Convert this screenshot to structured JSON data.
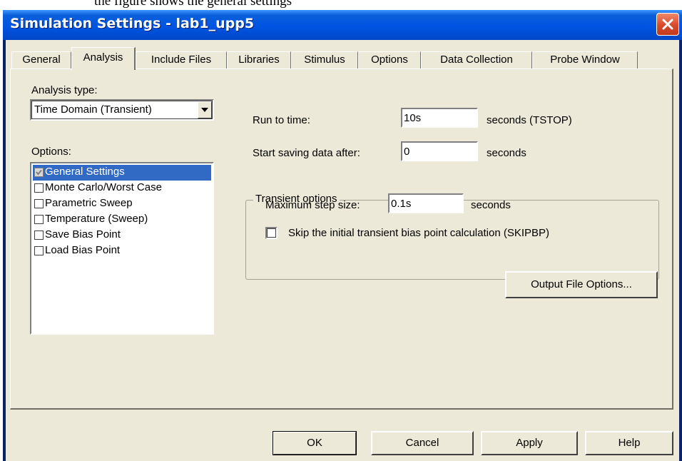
{
  "background_caption": "the figure shows the general settings",
  "window": {
    "title": "Simulation Settings - lab1_upp5",
    "close_icon": "close-x-icon"
  },
  "tabs": [
    {
      "label": "General",
      "active": false
    },
    {
      "label": "Analysis",
      "active": true
    },
    {
      "label": "Include Files",
      "active": false
    },
    {
      "label": "Libraries",
      "active": false
    },
    {
      "label": "Stimulus",
      "active": false
    },
    {
      "label": "Options",
      "active": false
    },
    {
      "label": "Data Collection",
      "active": false
    },
    {
      "label": "Probe Window",
      "active": false
    }
  ],
  "analysis": {
    "analysis_type_label": "Analysis type:",
    "analysis_type_value": "Time Domain (Transient)",
    "options_label": "Options:",
    "options": [
      {
        "label": "General Settings",
        "checked": true,
        "selected": true
      },
      {
        "label": "Monte Carlo/Worst Case",
        "checked": false,
        "selected": false
      },
      {
        "label": "Parametric Sweep",
        "checked": false,
        "selected": false
      },
      {
        "label": "Temperature (Sweep)",
        "checked": false,
        "selected": false
      },
      {
        "label": "Save Bias Point",
        "checked": false,
        "selected": false
      },
      {
        "label": "Load Bias Point",
        "checked": false,
        "selected": false
      }
    ],
    "run_to_time_label": "Run to time:",
    "run_to_time_value": "10s",
    "run_to_time_unit": "seconds  (TSTOP)",
    "start_saving_label": "Start saving data after:",
    "start_saving_value": "0",
    "start_saving_unit": "seconds",
    "transient_group_title": "Transient options",
    "max_step_label": "Maximum step size:",
    "max_step_value": "0.1s",
    "max_step_unit": "seconds",
    "skip_bias_label": "Skip the initial transient bias point calculation  (SKIPBP)",
    "skip_bias_checked": false,
    "output_file_options_label": "Output File Options..."
  },
  "footer": {
    "ok_label": "OK",
    "cancel_label": "Cancel",
    "apply_label": "Apply",
    "help_label": "Help"
  },
  "colors": {
    "titlebar_blue": "#0054e3",
    "dialog_face": "#ece9d8",
    "selection": "#316ac5",
    "close_red": "#d9482a"
  }
}
